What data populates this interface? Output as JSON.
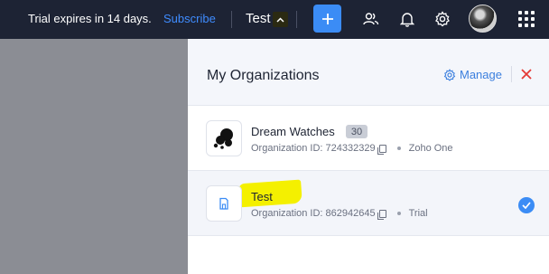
{
  "topbar": {
    "trial_text": "Trial expires in 14 days.",
    "subscribe_label": "Subscribe",
    "current_org": "Test",
    "icons": [
      "chevron-up-icon",
      "plus-icon",
      "users-icon",
      "bell-icon",
      "gear-icon",
      "avatar",
      "apps-grid-icon"
    ]
  },
  "panel": {
    "title": "My Organizations",
    "manage_label": "Manage",
    "orgs": [
      {
        "name": "Dream Watches",
        "count": "30",
        "id_label": "Organization ID: 724332329",
        "plan": "Zoho One",
        "selected": false
      },
      {
        "name": "Test",
        "id_label": "Organization ID: 862942645",
        "plan": "Trial",
        "selected": true
      }
    ]
  },
  "colors": {
    "topbar_bg": "#1d2334",
    "accent": "#3b8cf5",
    "close": "#e53935",
    "highlight": "#f4f000"
  }
}
